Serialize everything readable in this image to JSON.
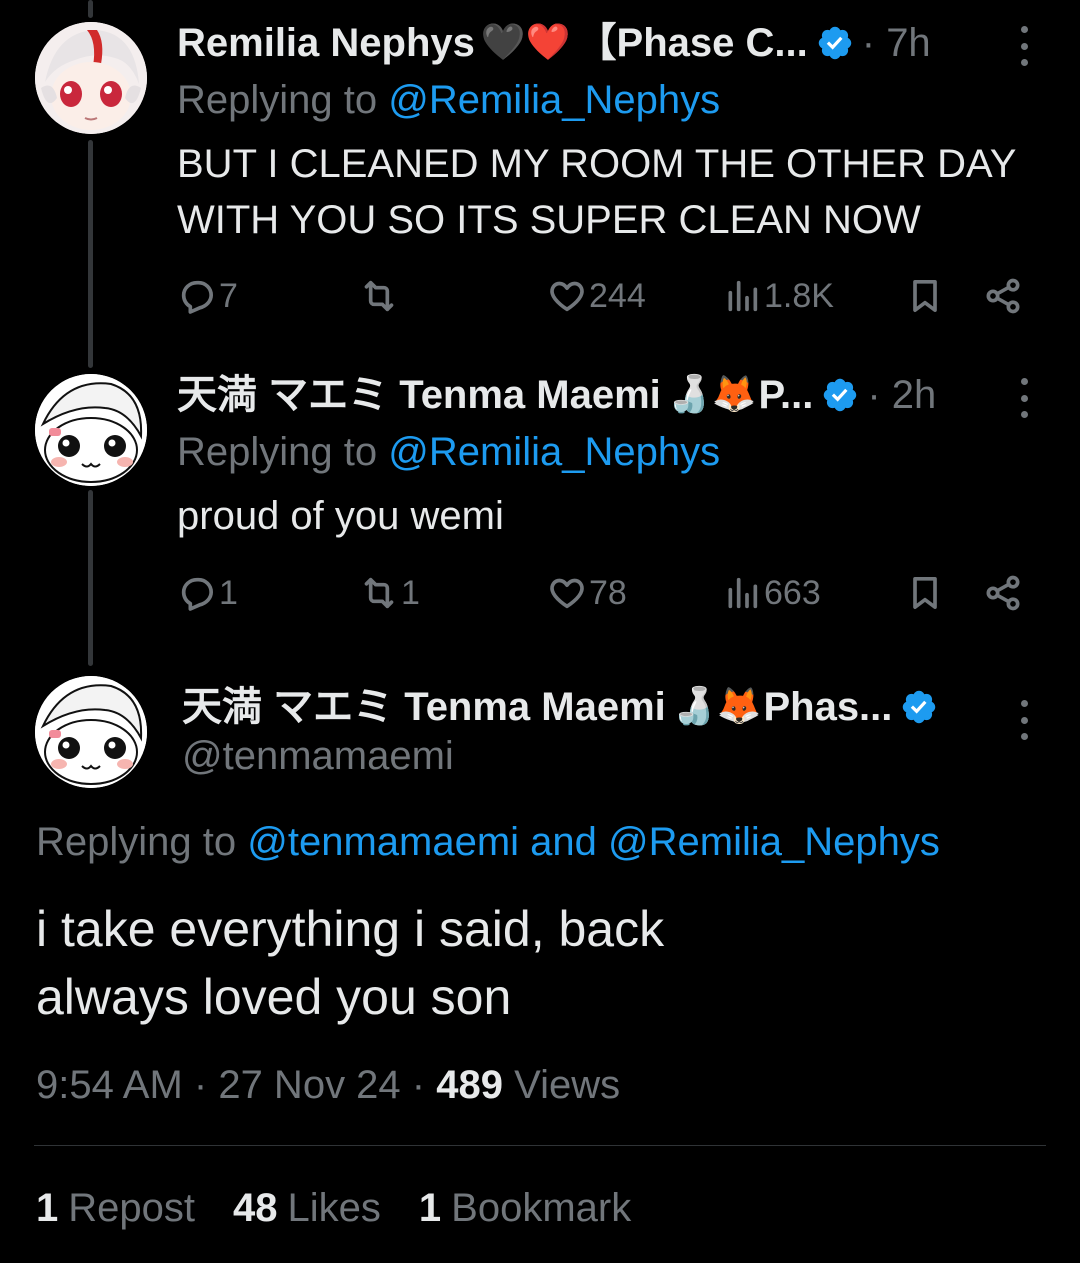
{
  "tweets": [
    {
      "name": "Remilia Nephys",
      "name_emoji": "🖤❤️",
      "name_suffix": "【Phase C...",
      "time": "7h",
      "replying_prefix": "Replying to",
      "replying_to": "@Remilia_Nephys",
      "text_line1": "BUT I CLEANED MY ROOM THE OTHER DAY",
      "text_line2": "WITH YOU SO ITS SUPER CLEAN NOW",
      "replies": "7",
      "reposts": "",
      "likes": "244",
      "views": "1.8K"
    },
    {
      "name": "天満 マエミ Tenma Maemi",
      "name_emoji": "🍶🦊",
      "name_suffix": "P...",
      "time": "2h",
      "replying_prefix": "Replying to",
      "replying_to": "@Remilia_Nephys",
      "text_line1": "proud of you wemi",
      "replies": "1",
      "reposts": "1",
      "likes": "78",
      "views": "663"
    }
  ],
  "focal": {
    "name": "天満 マエミ Tenma Maemi",
    "name_emoji": "🍶🦊",
    "name_suffix": "Phas...",
    "handle": "@tenmamaemi",
    "replying_prefix": "Replying to",
    "replying_to_1": "@tenmamaemi",
    "replying_and": "and",
    "replying_to_2": "@Remilia_Nephys",
    "text_line1": "i take everything i said, back",
    "text_line2": "always loved you son",
    "time": "9:54 AM",
    "date": "27 Nov 24",
    "views_count": "489",
    "views_label": "Views",
    "reposts_count": "1",
    "reposts_label": "Repost",
    "likes_count": "48",
    "likes_label": "Likes",
    "bookmarks_count": "1",
    "bookmarks_label": "Bookmark"
  },
  "colors": {
    "background": "#000000",
    "text": "#e7e9ea",
    "muted": "#71767b",
    "link": "#1d9bf0",
    "verified": "#1d9bf0"
  },
  "icons": [
    "reply-icon",
    "repost-icon",
    "like-icon",
    "views-icon",
    "bookmark-icon",
    "share-icon",
    "verified-icon",
    "more-icon"
  ]
}
